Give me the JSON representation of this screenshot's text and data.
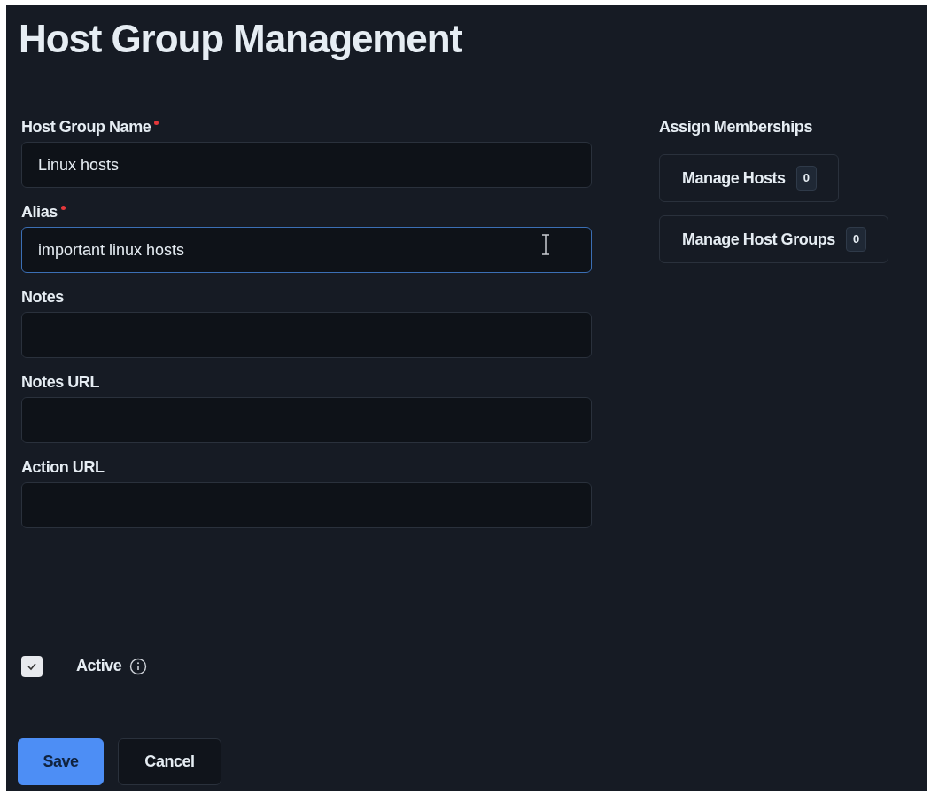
{
  "title": "Host Group Management",
  "fields": [
    {
      "label": "Host Group Name",
      "required": true,
      "value": "Linux hosts",
      "focused": false
    },
    {
      "label": "Alias",
      "required": true,
      "value": "important linux hosts",
      "focused": true
    },
    {
      "label": "Notes",
      "required": false,
      "focused": false
    },
    {
      "label": "Notes URL",
      "required": false,
      "focused": false
    },
    {
      "label": "Action URL",
      "required": false,
      "focused": false
    }
  ],
  "active": {
    "label": "Active",
    "checked": true
  },
  "memberships": {
    "heading": "Assign Memberships",
    "buttons": [
      {
        "label": "Manage Hosts",
        "count": "0"
      },
      {
        "label": "Manage Host Groups",
        "count": "0"
      }
    ]
  },
  "actions": [
    {
      "label": "Save",
      "kind": "primary"
    },
    {
      "label": "Cancel",
      "kind": "secondary"
    }
  ]
}
